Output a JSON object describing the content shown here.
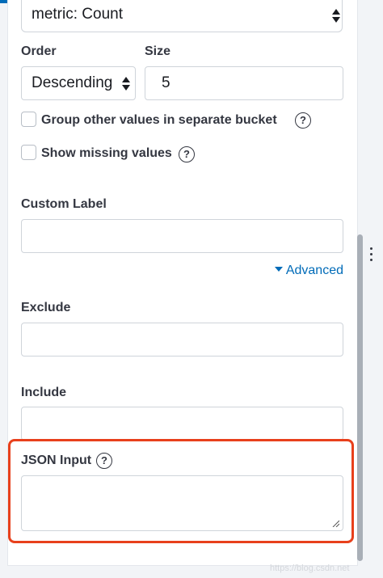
{
  "metric_select": {
    "value": "metric: Count"
  },
  "order": {
    "label": "Order",
    "value": "Descending"
  },
  "size": {
    "label": "Size",
    "value": "5"
  },
  "options": {
    "group_other": "Group other values in separate bucket",
    "show_missing": "Show missing values"
  },
  "help_glyph": "?",
  "custom_label": {
    "label": "Custom Label",
    "value": ""
  },
  "advanced_link": "Advanced",
  "exclude": {
    "label": "Exclude",
    "value": ""
  },
  "include": {
    "label": "Include",
    "value": ""
  },
  "json_input": {
    "label": "JSON Input",
    "value": ""
  },
  "watermark": "https://blog.csdn.net",
  "colors": {
    "accent": "#006bb8",
    "highlight": "#e8401c",
    "border": "#cfd4da"
  }
}
